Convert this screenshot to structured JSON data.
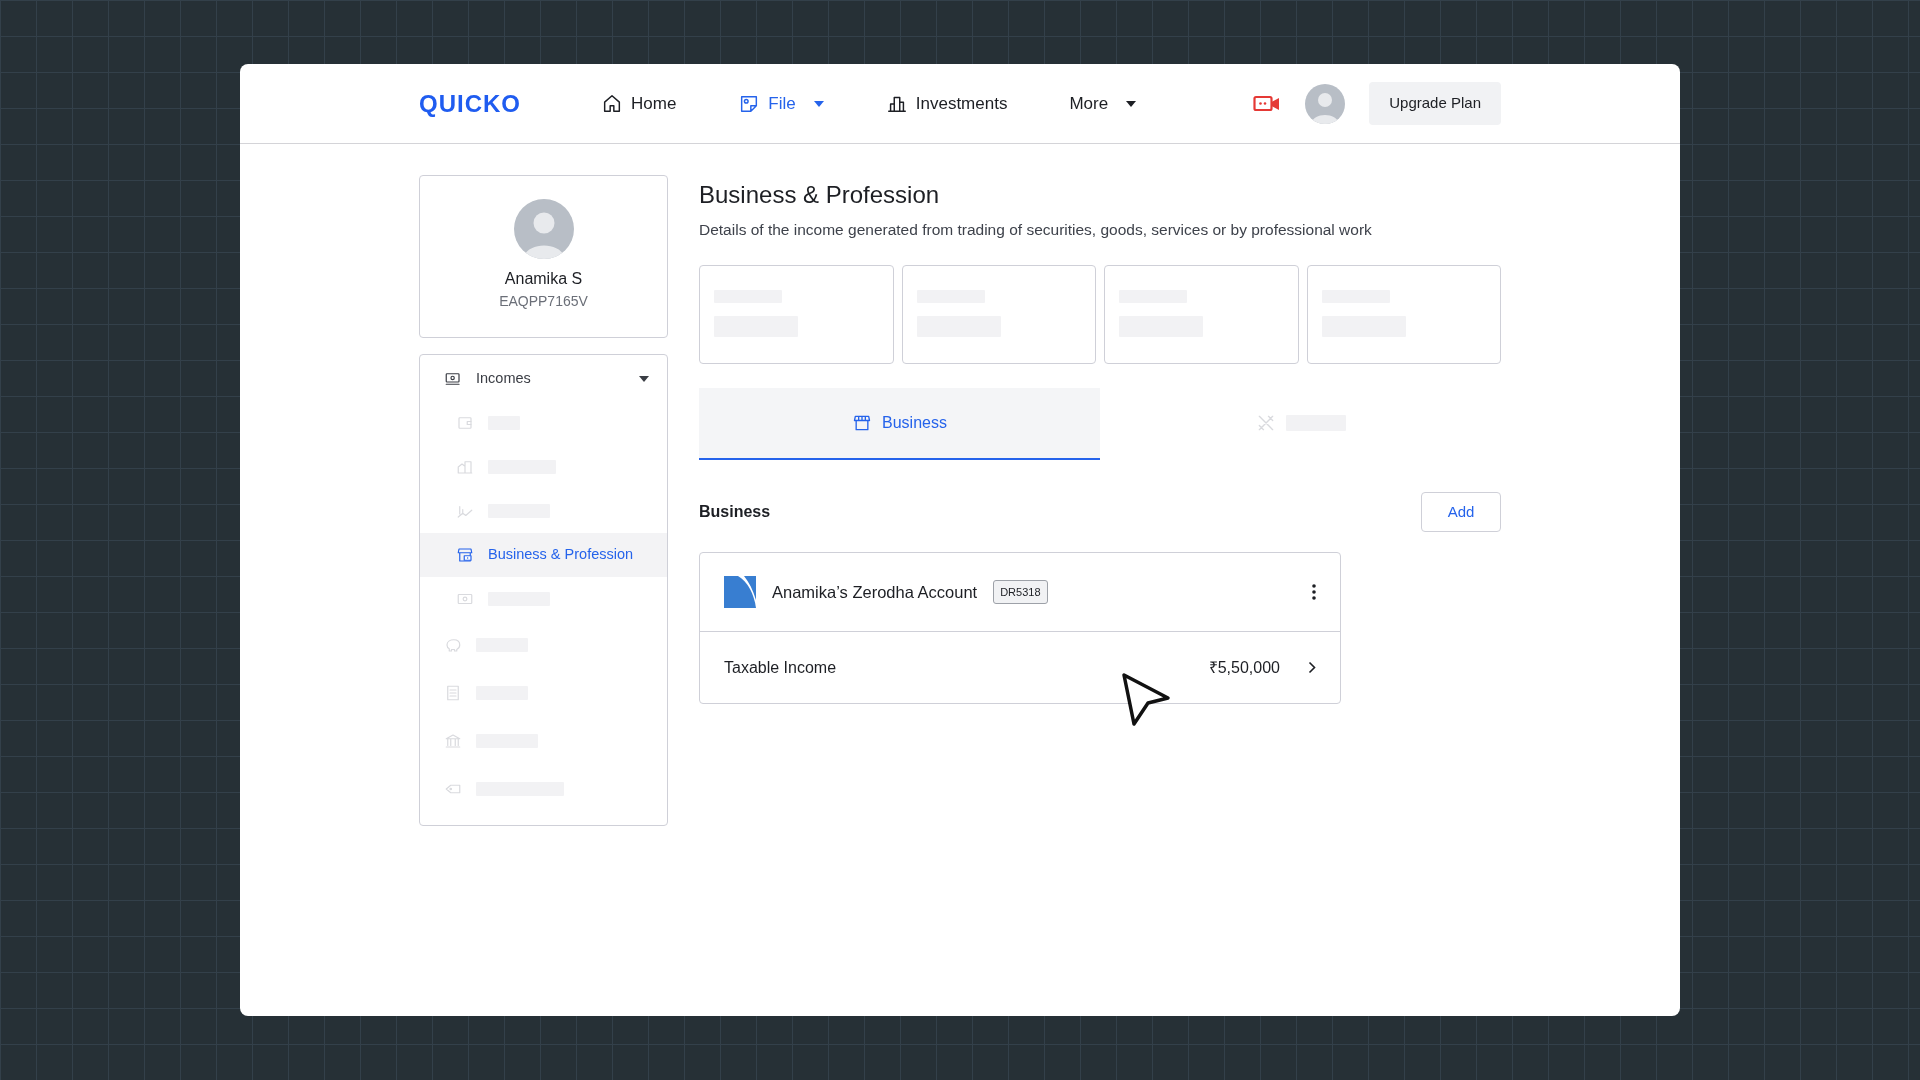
{
  "logo": "QUICKO",
  "nav": {
    "items": [
      {
        "label": "Home",
        "selected": false,
        "dropdown": false
      },
      {
        "label": "File",
        "selected": true,
        "dropdown": true
      },
      {
        "label": "Investments",
        "selected": false,
        "dropdown": false
      },
      {
        "label": "More",
        "selected": false,
        "dropdown": true
      }
    ],
    "upgrade_button": "Upgrade Plan"
  },
  "profile": {
    "name": "Anamika S",
    "pan": "EAQPP7165V"
  },
  "sidebar": {
    "items": [
      {
        "kind": "group",
        "label": "Incomes",
        "expanded": true,
        "children": [
          {
            "kind": "skeleton",
            "selected": false
          },
          {
            "kind": "skeleton",
            "selected": false
          },
          {
            "kind": "skeleton",
            "selected": false
          },
          {
            "kind": "link",
            "label": "Business & Profession",
            "selected": true
          },
          {
            "kind": "skeleton",
            "selected": false
          }
        ]
      },
      {
        "kind": "skeleton",
        "selected": false
      },
      {
        "kind": "skeleton",
        "selected": false
      },
      {
        "kind": "skeleton",
        "selected": false
      },
      {
        "kind": "skeleton",
        "selected": false
      }
    ]
  },
  "page": {
    "title": "Business & Profession",
    "description": "Details of the income generated from trading of securities, goods, services or by professional work"
  },
  "summary_cards": [
    {
      "loading": true
    },
    {
      "loading": true
    },
    {
      "loading": true
    },
    {
      "loading": true
    }
  ],
  "tabs": [
    {
      "kind": "label",
      "label": "Business",
      "selected": true
    },
    {
      "kind": "skeleton",
      "selected": false
    }
  ],
  "section": {
    "title": "Business",
    "add_button": "Add"
  },
  "accounts": [
    {
      "name": "Anamika’s Zerodha Account",
      "code": "DR5318",
      "rows": [
        {
          "label": "Taxable Income",
          "value": "₹5,50,000"
        }
      ]
    }
  ]
}
